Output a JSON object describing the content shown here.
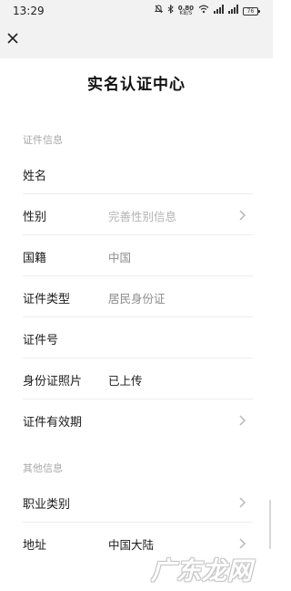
{
  "status_bar": {
    "time": "13:29",
    "speed_value": "0.80",
    "speed_unit": "KB/S",
    "battery": "76"
  },
  "header": {
    "close_icon": "close-icon"
  },
  "page": {
    "title": "实名认证中心"
  },
  "sections": [
    {
      "title": "证件信息",
      "rows": [
        {
          "label": "姓名",
          "value": ""
        },
        {
          "label": "性别",
          "value": "完善性别信息",
          "placeholder": true,
          "chevron": true
        },
        {
          "label": "国籍",
          "value": "中国"
        },
        {
          "label": "证件类型",
          "value": "居民身份证"
        },
        {
          "label": "证件号",
          "value": ""
        },
        {
          "label": "身份证照片",
          "value": "已上传"
        },
        {
          "label": "证件有效期",
          "value": "",
          "chevron": true
        }
      ]
    },
    {
      "title": "其他信息",
      "rows": [
        {
          "label": "职业类别",
          "value": "",
          "chevron": true
        },
        {
          "label": "地址",
          "value": "中国大陆",
          "chevron": true
        }
      ]
    }
  ],
  "watermark": "广东龙网",
  "colors": {
    "header_bg": "#f2f2f2",
    "placeholder": "#b3b3b3",
    "section_title": "#a8a8a8"
  }
}
